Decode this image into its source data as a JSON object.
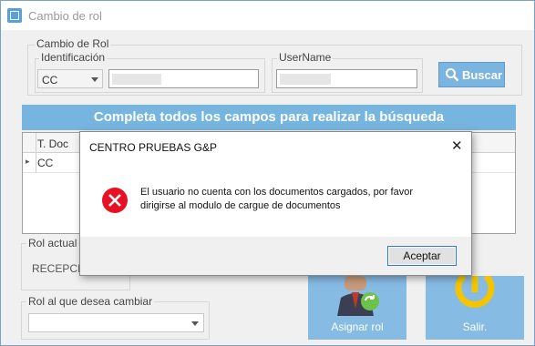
{
  "window": {
    "title": "Cambio de rol"
  },
  "search_group": {
    "title": "Cambio de Rol",
    "id_label": "Identificación",
    "id_type_value": "CC",
    "username_label": "UserName",
    "search_button": "Buscar"
  },
  "banner": {
    "text": "Completa todos los campos para realizar la búsqueda"
  },
  "grid": {
    "columns": [
      "T. Doc"
    ],
    "rows": [
      {
        "marker": "▸",
        "t_doc": "CC"
      }
    ]
  },
  "current_role": {
    "label": "Rol actual",
    "value": "RECEPCIO"
  },
  "new_role": {
    "label": "Rol al que desea cambiar",
    "value": ""
  },
  "actions": {
    "assign": "Asignar rol",
    "exit": "Salir."
  },
  "dialog": {
    "title": "CENTRO PRUEBAS G&P",
    "message_line1": "El usuario no cuenta con los documentos cargados, por favor",
    "message_line2": "dirigirse al modulo de cargue de documentos",
    "ok": "Aceptar",
    "close_glyph": "✕"
  },
  "colors": {
    "accent": "#76b5df",
    "error": "#e81123"
  }
}
